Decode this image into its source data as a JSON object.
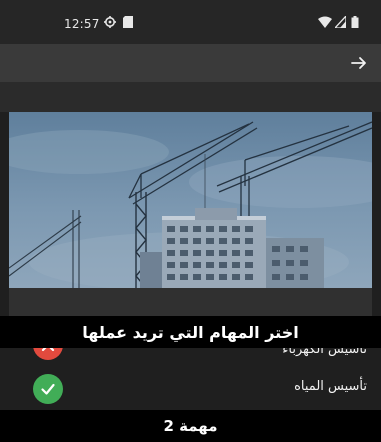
{
  "status_bar": {
    "time": "12:57",
    "icons": [
      "gear-icon",
      "sd-card-icon",
      "wifi-icon",
      "signal-icon",
      "battery-icon"
    ]
  },
  "app_bar": {
    "back_icon": "arrow-right-icon"
  },
  "hero_image": {
    "subject": "construction-cranes-building"
  },
  "prompt": {
    "text": "اختر المهام التي تريد عملها"
  },
  "tasks": [
    {
      "label": "تأسيس الكهرباء",
      "status": "unselected",
      "status_icon": "close-icon",
      "status_color": "#e24a3e"
    },
    {
      "label": "تأسيس المياه",
      "status": "selected",
      "status_icon": "check-icon",
      "status_color": "#41ad57"
    }
  ],
  "footer": {
    "text": "مهمة 2"
  },
  "colors": {
    "background": "#1f1f1f",
    "app_bar": "#3a3a3a",
    "banner": "#000000"
  }
}
